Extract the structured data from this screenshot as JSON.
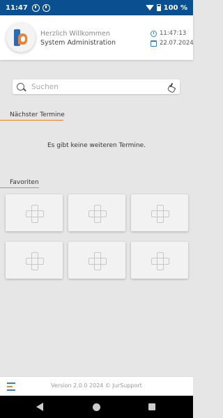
{
  "status_bar": {
    "time": "11:47",
    "battery": "100 %"
  },
  "header": {
    "welcome": "Herzlich Willkommen",
    "user": "System Administration",
    "time": "11:47:13",
    "date": "22.07.2024"
  },
  "search": {
    "placeholder": "Suchen"
  },
  "appointments": {
    "title": "Nächster Termine",
    "empty_message": "Es gibt keine weiteren Termine."
  },
  "favorites": {
    "title": "Favoriten",
    "tiles": [
      {
        "icon": "plus-icon"
      },
      {
        "icon": "plus-icon"
      },
      {
        "icon": "plus-icon"
      },
      {
        "icon": "plus-icon"
      },
      {
        "icon": "plus-icon"
      },
      {
        "icon": "plus-icon"
      }
    ]
  },
  "footer": {
    "version": "Version 2.0.0 2024 © JurSupport"
  },
  "colors": {
    "status_bar": "#0a4f8f",
    "accent_blue": "#3b7bc0",
    "accent_orange": "#e8833a",
    "background": "#e6e6e6"
  }
}
